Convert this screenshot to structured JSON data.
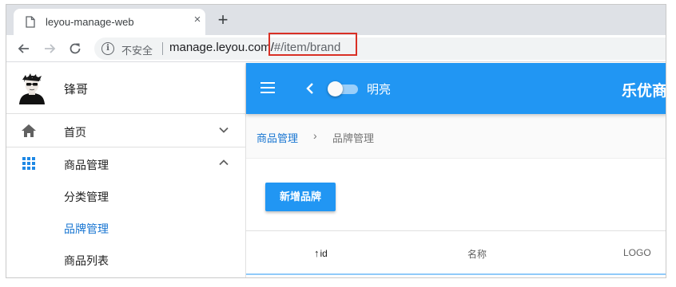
{
  "browser": {
    "tab_title": "leyou-manage-web",
    "tab_close": "×",
    "new_tab": "+",
    "insecure_label": "不安全",
    "url_host": "manage.leyou.com/",
    "url_path": "#/item/brand"
  },
  "sidebar": {
    "user_name": "锋哥",
    "items": [
      {
        "label": "首页",
        "icon": "home-icon",
        "expanded": false
      },
      {
        "label": "商品管理",
        "icon": "apps-icon",
        "expanded": true
      }
    ],
    "sub_items": [
      {
        "label": "分类管理",
        "active": false
      },
      {
        "label": "品牌管理",
        "active": true
      },
      {
        "label": "商品列表",
        "active": false
      }
    ]
  },
  "appbar": {
    "switch_label": "明亮",
    "title": "乐优商"
  },
  "breadcrumb": {
    "parent": "商品管理",
    "separator": "›",
    "current": "品牌管理"
  },
  "toolbar": {
    "add_label": "新增品牌"
  },
  "table": {
    "sort_arrow": "↑",
    "headers": [
      "id",
      "名称",
      "LOGO"
    ]
  },
  "colors": {
    "primary": "#2196f3",
    "link": "#1976d2",
    "highlight": "#d93025"
  }
}
